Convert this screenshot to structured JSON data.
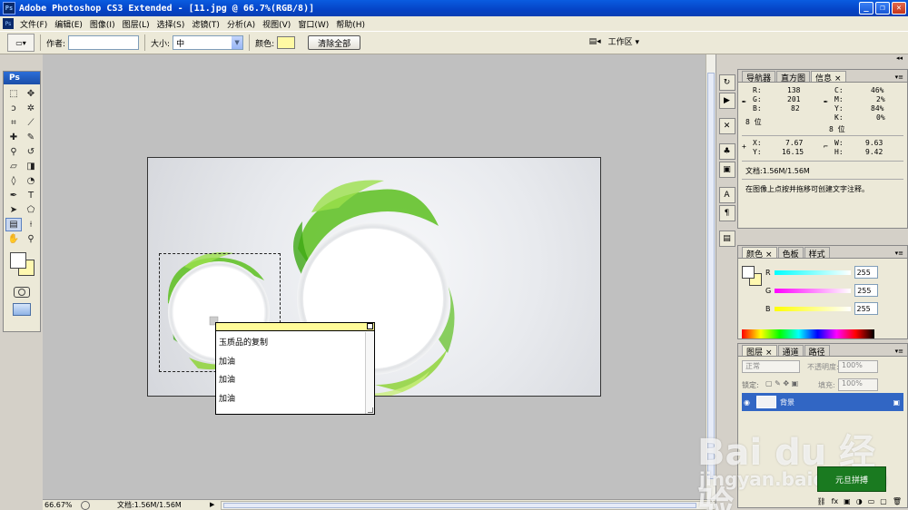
{
  "window": {
    "title": "Adobe Photoshop CS3 Extended - [11.jpg @ 66.7%(RGB/8)]",
    "app_icon": "Ps",
    "minimize": "_",
    "maximize": "❐",
    "close": "✕"
  },
  "menu": {
    "items": [
      "文件(F)",
      "编辑(E)",
      "图像(I)",
      "图层(L)",
      "选择(S)",
      "滤镜(T)",
      "分析(A)",
      "视图(V)",
      "窗口(W)",
      "帮助(H)"
    ]
  },
  "options": {
    "author_label": "作者:",
    "author_value": "",
    "size_label": "大小:",
    "size_value": "中",
    "color_label": "颜色:",
    "note_color": "#fff9a3",
    "clear_all": "清除全部",
    "workspace": "工作区 ▾"
  },
  "toolbox": {
    "logo": "Ps",
    "foreground_color": "#ffffff",
    "background_color": "#fff8b0"
  },
  "note": {
    "lines": [
      "玉质品的复制",
      "加油",
      "加油",
      "加油"
    ]
  },
  "status": {
    "zoom": "66.67%",
    "doc": "文档:1.56M/1.56M",
    "arrow": "▶"
  },
  "panels": {
    "info": {
      "tabs": [
        "导航器",
        "直方图",
        "信息"
      ],
      "close": "×",
      "R": "R:",
      "R_val": "138",
      "G": "G:",
      "G_val": "201",
      "B": "B:",
      "B_val": "82",
      "C": "C:",
      "C_val": "46%",
      "M": "M:",
      "M_val": "2%",
      "Y": "Y:",
      "Y_val": "84%",
      "K": "K:",
      "K_val": "0%",
      "bit_left": "8 位",
      "bit_right": "8 位",
      "X": "X:",
      "X_val": "7.67",
      "Y2": "Y:",
      "Y2_val": "16.15",
      "W": "W:",
      "W_val": "9.63",
      "H": "H:",
      "H_val": "9.42",
      "doc": "文档:1.56M/1.56M",
      "hint": "在图像上点按并拖移可创建文字注释。"
    },
    "color": {
      "tabs": [
        "颜色",
        "色板",
        "样式"
      ],
      "close": "×",
      "R": "R",
      "G": "G",
      "B": "B",
      "R_val": "255",
      "G_val": "255",
      "B_val": "255"
    },
    "layers": {
      "tabs": [
        "图层",
        "通道",
        "路径"
      ],
      "close": "×",
      "blend_mode": "正常",
      "opacity_label": "不透明度:",
      "opacity_value": "100%",
      "lock_label": "锁定:",
      "fill_label": "填充:",
      "fill_value": "100%",
      "layer_name": "背景"
    }
  },
  "watermark": {
    "logo": "Bai du 经验",
    "url": "jingyan.baidu.com",
    "badge": "元旦拼搏"
  }
}
